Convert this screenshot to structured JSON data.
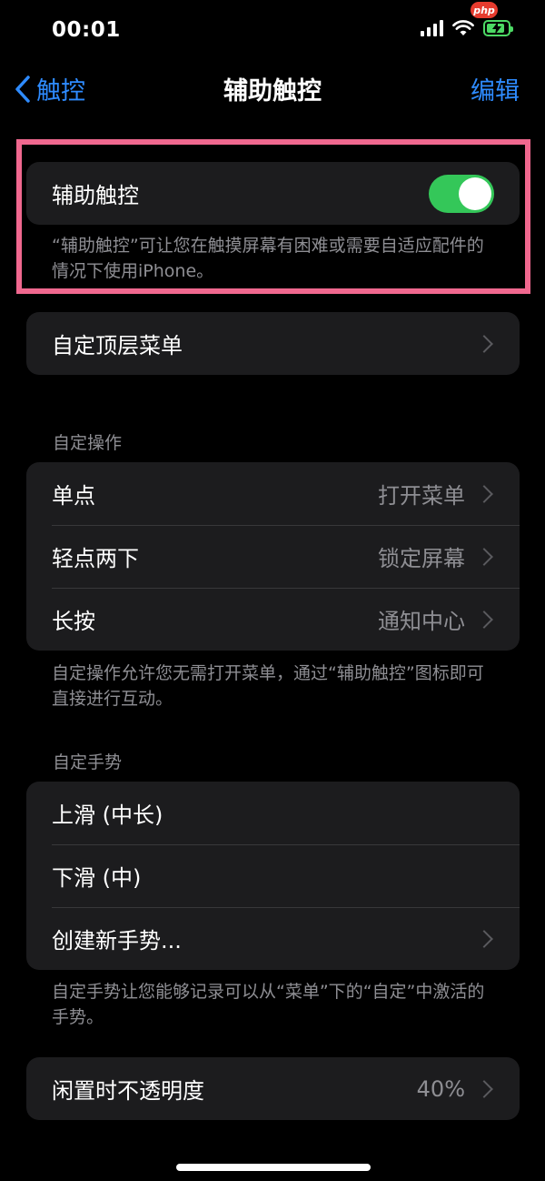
{
  "status_bar": {
    "time": "00:01",
    "watermark": "php",
    "battery_level": 0.85
  },
  "nav": {
    "back_label": "触控",
    "title": "辅助触控",
    "edit_label": "编辑"
  },
  "assistive_touch": {
    "label": "辅助触控",
    "enabled": true,
    "description": "“辅助触控”可让您在触摸屏幕有困难或需要自适应配件的情况下使用iPhone。"
  },
  "top_menu": {
    "label": "自定顶层菜单"
  },
  "custom_actions": {
    "header": "自定操作",
    "rows": [
      {
        "label": "单点",
        "value": "打开菜单"
      },
      {
        "label": "轻点两下",
        "value": "锁定屏幕"
      },
      {
        "label": "长按",
        "value": "通知中心"
      }
    ],
    "footnote": "自定操作允许您无需打开菜单，通过“辅助触控”图标即可直接进行互动。"
  },
  "custom_gestures": {
    "header": "自定手势",
    "rows": [
      {
        "label": "上滑 (中长)"
      },
      {
        "label": "下滑 (中)"
      },
      {
        "label": "创建新手势..."
      }
    ],
    "footnote": "自定手势让您能够记录可以从“菜单”下的“自定”中激活的手势。"
  },
  "idle_opacity": {
    "label": "闲置时不透明度",
    "value": "40%"
  },
  "colors": {
    "accent": "#2e8bff",
    "toggle_on": "#34c759",
    "highlight": "#f0688f",
    "cell_bg": "#1c1c1e"
  }
}
